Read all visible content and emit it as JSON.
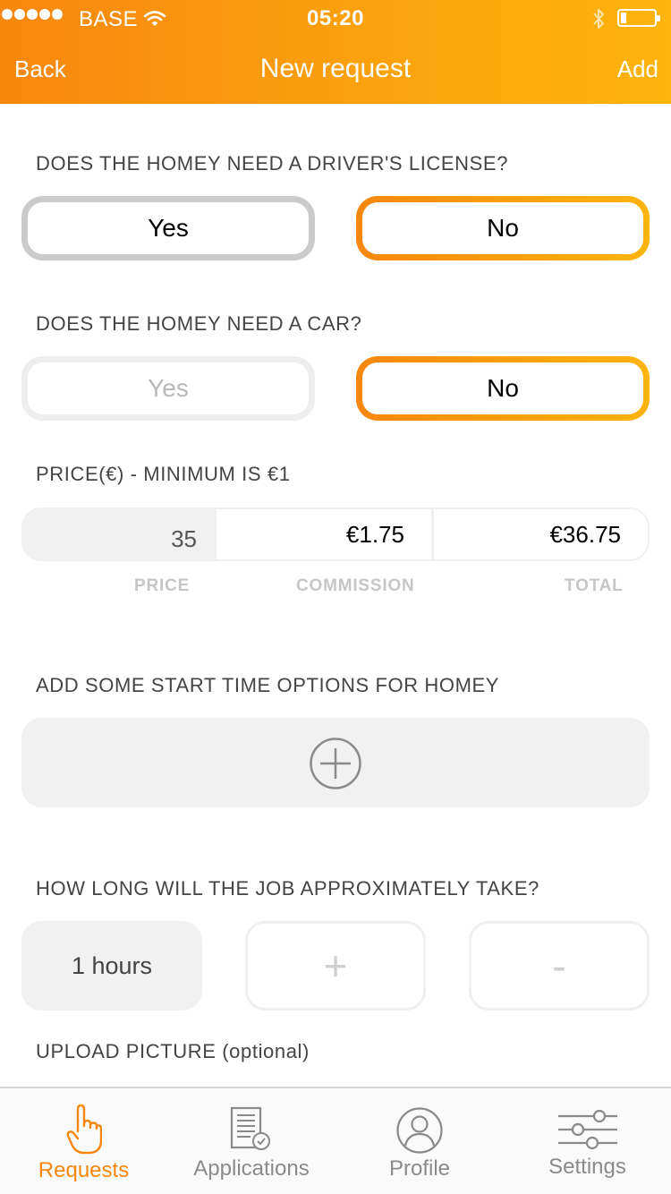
{
  "status_bar": {
    "carrier": "BASE",
    "time": "05:20",
    "signal_bars": 5
  },
  "nav": {
    "back_label": "Back",
    "title": "New request",
    "add_label": "Add"
  },
  "license_question": {
    "label": "DOES THE HOMEY NEED A DRIVER'S LICENSE?",
    "yes_label": "Yes",
    "no_label": "No",
    "selected": "No"
  },
  "car_question": {
    "label": "DOES THE HOMEY NEED A CAR?",
    "yes_label": "Yes",
    "no_label": "No",
    "selected": "No"
  },
  "price": {
    "label": "PRICE(€) - MINIMUM IS €1",
    "price_value": "35",
    "commission_value": "€1.75",
    "total_value": "€36.75",
    "price_caption": "PRICE",
    "commission_caption": "COMMISSION",
    "total_caption": "TOTAL"
  },
  "start_time": {
    "label": "ADD SOME START TIME OPTIONS FOR HOMEY",
    "icon": "plus-circle-icon"
  },
  "duration": {
    "label": "HOW LONG WILL THE JOB APPROXIMATELY TAKE?",
    "value": "1 hours",
    "increment_label": "+",
    "decrement_label": "-"
  },
  "upload": {
    "label": "UPLOAD PICTURE (optional)"
  },
  "tabs": [
    {
      "label": "Requests",
      "icon": "pointing-hand-icon",
      "active": true
    },
    {
      "label": "Applications",
      "icon": "document-check-icon",
      "active": false
    },
    {
      "label": "Profile",
      "icon": "person-circle-icon",
      "active": false
    },
    {
      "label": "Settings",
      "icon": "sliders-icon",
      "active": false
    }
  ],
  "colors": {
    "accent_start": "#f7870e",
    "accent_end": "#fdb40d",
    "inactive_tab": "#8a8a8a"
  }
}
